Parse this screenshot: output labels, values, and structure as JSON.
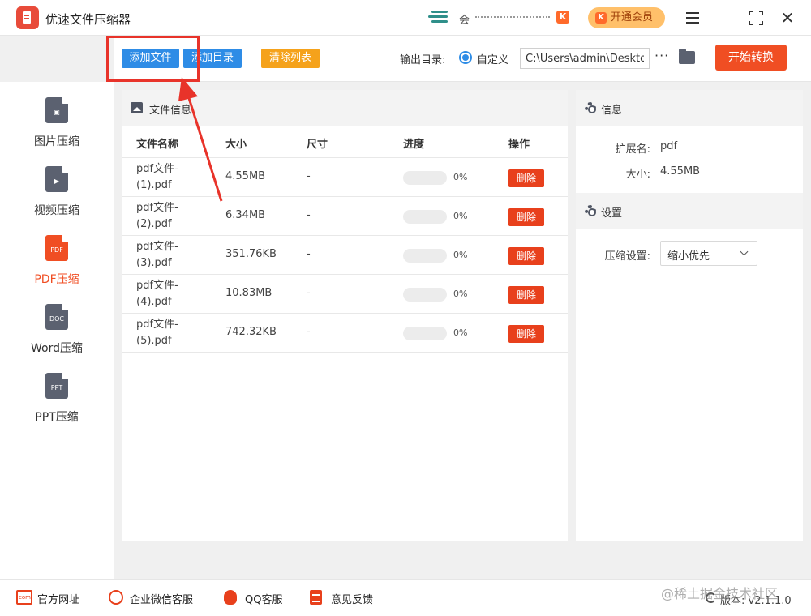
{
  "app": {
    "title": "优速文件压缩器"
  },
  "account": {
    "name_visible": "会",
    "name_masked": "·· · · · · · · ····",
    "vip_badge": "K"
  },
  "vip_button": {
    "icon": "K",
    "label": "开通会员"
  },
  "window_controls": {
    "menu": "menu-icon",
    "maximize": "maximize-icon",
    "close": "✕"
  },
  "sidebar": {
    "items": [
      {
        "label": "图片压缩",
        "icon": "image-file-icon",
        "glyph": "▣",
        "active": false
      },
      {
        "label": "视频压缩",
        "icon": "video-file-icon",
        "glyph": "▶",
        "active": false
      },
      {
        "label": "PDF压缩",
        "icon": "pdf-file-icon",
        "glyph": "PDF",
        "active": true
      },
      {
        "label": "Word压缩",
        "icon": "doc-file-icon",
        "glyph": "DOC",
        "active": false
      },
      {
        "label": "PPT压缩",
        "icon": "ppt-file-icon",
        "glyph": "PPT",
        "active": false
      }
    ]
  },
  "toolbar": {
    "add_file": "添加文件",
    "add_dir": "添加目录",
    "clear_list": "清除列表",
    "output_label": "输出目录:",
    "radio_label": "自定义",
    "output_path": "C:\\Users\\admin\\Deskto",
    "more": "···",
    "start": "开始转换"
  },
  "file_panel": {
    "title": "文件信息",
    "columns": [
      "文件名称",
      "大小",
      "尺寸",
      "进度",
      "操作"
    ],
    "rows": [
      {
        "name": "pdf文件-(1).pdf",
        "size": "4.55MB",
        "dim": "-",
        "progress_pct": "0%",
        "progress_fraction": 0,
        "action": "删除"
      },
      {
        "name": "pdf文件-(2).pdf",
        "size": "6.34MB",
        "dim": "-",
        "progress_pct": "0%",
        "progress_fraction": 0,
        "action": "删除"
      },
      {
        "name": "pdf文件-(3).pdf",
        "size": "351.76KB",
        "dim": "-",
        "progress_pct": "0%",
        "progress_fraction": 0,
        "action": "删除"
      },
      {
        "name": "pdf文件-(4).pdf",
        "size": "10.83MB",
        "dim": "-",
        "progress_pct": "0%",
        "progress_fraction": 0,
        "action": "删除"
      },
      {
        "name": "pdf文件-(5).pdf",
        "size": "742.32KB",
        "dim": "-",
        "progress_pct": "0%",
        "progress_fraction": 0,
        "action": "删除"
      }
    ]
  },
  "info": {
    "title": "信息",
    "ext_label": "扩展名:",
    "ext_value": "pdf",
    "size_label": "大小:",
    "size_value": "4.55MB"
  },
  "settings": {
    "title": "设置",
    "compress_label": "压缩设置:",
    "compress_value": "缩小优先"
  },
  "footer": {
    "links": [
      "官方网址",
      "企业微信客服",
      "QQ客服",
      "意见反馈"
    ],
    "version": "版本: v2.1.1.0",
    "watermark": "@稀土掘金技术社区"
  },
  "colors": {
    "accent_blue": "#2e8ce6",
    "accent_red": "#f04e23",
    "clear_orange": "#f5a21b",
    "vip_gold": "#ffc06a",
    "annotation_red": "#e8332a"
  }
}
